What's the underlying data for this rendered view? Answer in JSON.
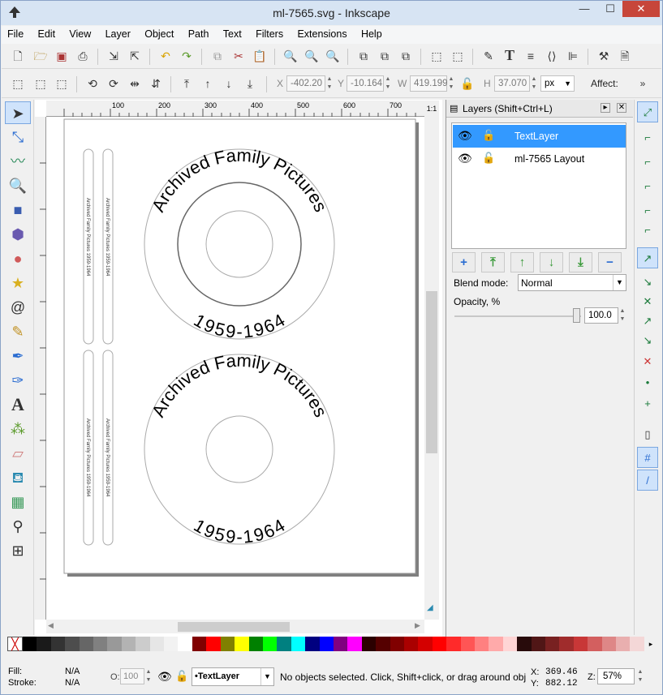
{
  "window": {
    "title": "ml-7565.svg - Inkscape",
    "minimize": "—",
    "maximize": "☐",
    "close": "✕"
  },
  "menu": [
    "File",
    "Edit",
    "View",
    "Layer",
    "Object",
    "Path",
    "Text",
    "Filters",
    "Extensions",
    "Help"
  ],
  "toolbar": {
    "x_label": "X",
    "x_value": "-402.20",
    "y_label": "Y",
    "y_value": "-10.164",
    "w_label": "W",
    "w_value": "419.199",
    "h_label": "H",
    "h_value": "37.070",
    "unit": "px",
    "affect_label": "Affect:"
  },
  "ruler": {
    "h_ticks": [
      "100",
      "200",
      "300",
      "400",
      "500",
      "600",
      "700"
    ],
    "v_ticks": [
      "100",
      "200",
      "300",
      "400",
      "500",
      "600",
      "700"
    ]
  },
  "canvas": {
    "cd_top": {
      "title": "Archived Family Pictures",
      "years": "1959-1964"
    },
    "cd_bottom": {
      "title": "Archived Family Pictures",
      "years": "1959-1964"
    },
    "spine_text": "Archived Family Pictures 1959-1964"
  },
  "layers_panel": {
    "title": "Layers (Shift+Ctrl+L)",
    "layers": [
      {
        "name": "TextLayer",
        "selected": true
      },
      {
        "name": "ml-7565 Layout",
        "selected": false
      }
    ],
    "blend_label": "Blend mode:",
    "blend_value": "Normal",
    "opacity_label": "Opacity, %",
    "opacity_value": "100.0"
  },
  "palette": [
    "#000000",
    "#1a1a1a",
    "#333333",
    "#4d4d4d",
    "#666666",
    "#808080",
    "#999999",
    "#b3b3b3",
    "#cccccc",
    "#e6e6e6",
    "#f2f2f2",
    "#ffffff",
    "#800000",
    "#ff0000",
    "#808000",
    "#ffff00",
    "#008000",
    "#00ff00",
    "#008080",
    "#00ffff",
    "#000080",
    "#0000ff",
    "#800080",
    "#ff00ff",
    "#2b0000",
    "#550000",
    "#800000",
    "#aa0000",
    "#d40000",
    "#ff0000",
    "#ff2a2a",
    "#ff5555",
    "#ff8080",
    "#ffaaaa",
    "#ffd5d5",
    "#280b0b",
    "#501616",
    "#782121",
    "#a02c2c",
    "#c83737",
    "#d35f5f",
    "#de8787",
    "#e9afaf",
    "#f4d7d7"
  ],
  "status": {
    "fill_label": "Fill:",
    "fill_value": "N/A",
    "stroke_label": "Stroke:",
    "stroke_value": "N/A",
    "o_label": "O:",
    "o_value": "100",
    "layer_value": "•TextLayer",
    "message": "No objects selected. Click, Shift+click, or drag around obj",
    "x_label": "X:",
    "x_value": "369.46",
    "y_label": "Y:",
    "y_value": "882.12",
    "z_label": "Z:",
    "zoom": "57%"
  }
}
